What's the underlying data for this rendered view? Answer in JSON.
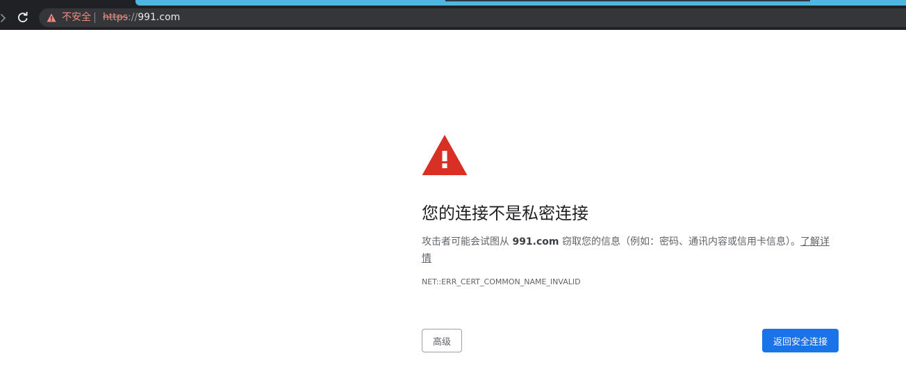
{
  "browser": {
    "security_label": "不安全",
    "url_scheme": "https",
    "url_separator": "://",
    "url_host": "991.com",
    "icons": {
      "forward": "forward-arrow-icon",
      "reload": "reload-icon",
      "security": "warning-triangle-icon"
    }
  },
  "interstitial": {
    "icon": "warning-triangle-icon",
    "heading": "您的连接不是私密连接",
    "desc_prefix": "攻击者可能会试图从 ",
    "desc_host": "991.com",
    "desc_suffix": " 窃取您的信息（例如：密码、通讯内容或信用卡信息）。",
    "learn_more": "了解详情",
    "error_code": "NET::ERR_CERT_COMMON_NAME_INVALID",
    "advanced_button": "高级",
    "back_button": "返回安全连接"
  },
  "colors": {
    "toolbar_bg": "#202124",
    "omnibox_bg": "#35363a",
    "tab_accent": "#4fb6e1",
    "danger": "#f28b82",
    "warning_icon": "#d93025",
    "primary": "#1a73e8"
  }
}
